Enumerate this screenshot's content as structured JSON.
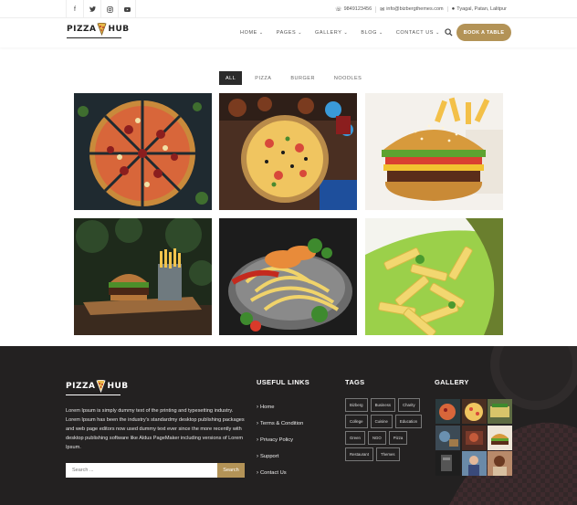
{
  "topbar": {
    "social_icons": [
      "facebook-icon",
      "twitter-icon",
      "instagram-icon",
      "youtube-icon"
    ],
    "phone": "9849123456",
    "email": "info@bizbergthemes.com",
    "address": "Tyagal, Patan, Lalitpur"
  },
  "brand": {
    "left": "PIZZA",
    "right": "HUB"
  },
  "nav": {
    "items": [
      {
        "label": "HOME"
      },
      {
        "label": "PAGES"
      },
      {
        "label": "GALLERY"
      },
      {
        "label": "BLOG"
      },
      {
        "label": "CONTACT US"
      }
    ],
    "book_label": "BOOK A TABLE"
  },
  "filters": [
    "ALL",
    "PIZZA",
    "BURGER",
    "NOODLES"
  ],
  "active_filter": "ALL",
  "gallery": [
    {
      "icon": "pizza-slices-photo"
    },
    {
      "icon": "pizza-table-photo"
    },
    {
      "icon": "burger-photo"
    },
    {
      "icon": "burger-fries-photo"
    },
    {
      "icon": "noodles-pan-photo"
    },
    {
      "icon": "penne-plate-photo"
    }
  ],
  "footer": {
    "about": "Lorem Ipsum is simply dummy text of the printing and typesetting industry. Lorem Ipsum has been the industry's standardmy desktop publishing packages and web page editors now used dummy text ever since the more recently with desktop publishing software like Aldus PageMaker including versions of Lorem Ipsum.",
    "search_placeholder": "Search ...",
    "search_button": "Search",
    "useful_links_title": "USEFUL LINKS",
    "links": [
      "Home",
      "Terms & Condition",
      "Privacy Policy",
      "Support",
      "Contact Us"
    ],
    "tags_title": "TAGS",
    "tags": [
      "Bizberg",
      "Business",
      "Charity",
      "College",
      "Cuisine",
      "Education",
      "Green",
      "NGO",
      "Pizza",
      "Restaurant",
      "Themes"
    ],
    "gallery_title": "GALLERY"
  },
  "colors": {
    "accent": "#b39357",
    "footer_bg": "#232121",
    "filter_active": "#2b2b2b"
  }
}
